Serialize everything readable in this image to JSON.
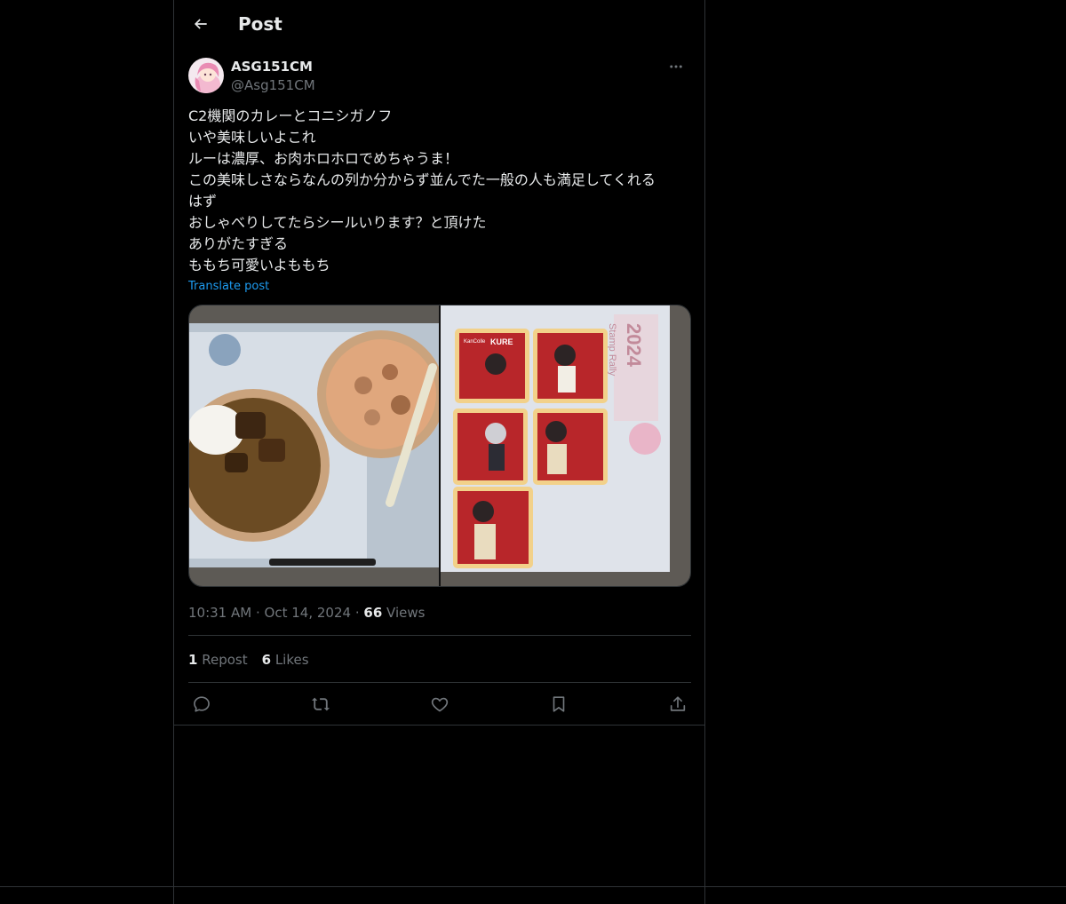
{
  "header": {
    "title": "Post"
  },
  "post": {
    "author": {
      "display_name": "ASG151CM",
      "handle": "@Asg151CM"
    },
    "text_lines": [
      "C2機関のカレーとコニシガノフ",
      "いや美味しいよこれ",
      "ルーは濃厚、お肉ホロホロでめちゃうま！",
      "この美味しさならなんの列か分からず並んでた一般の人も満足してくれる",
      "はず",
      "おしゃべりしてたらシールいります？と頂けた",
      "ありがたすぎる",
      "ももち可愛いよももち"
    ],
    "translate_label": "Translate post",
    "time": "10:31 AM",
    "date": "Oct 14, 2024",
    "separator": "·",
    "views_count": "66",
    "views_label": "Views",
    "reposts_count": "1",
    "reposts_label": "Repost",
    "likes_count": "6",
    "likes_label": "Likes",
    "media_text": [
      "KURE",
      "KanColle",
      "2024",
      "Stamp Rally"
    ]
  },
  "icons": {
    "back": "back-arrow-icon",
    "more": "more-icon",
    "reply": "reply-icon",
    "repost": "repost-icon",
    "like": "like-icon",
    "bookmark": "bookmark-icon",
    "share": "share-icon"
  },
  "colors": {
    "background": "#000000",
    "text": "#e7e9ea",
    "muted": "#71767b",
    "link": "#1d9bf0",
    "border": "#2f3336"
  }
}
